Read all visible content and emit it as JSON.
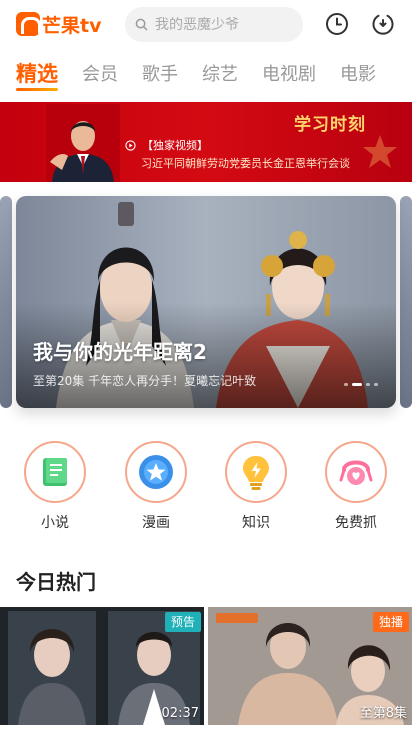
{
  "app": {
    "brand": "芒果tv"
  },
  "search": {
    "placeholder": "我的恶魔少爷"
  },
  "tabs": [
    {
      "label": "精选"
    },
    {
      "label": "会员"
    },
    {
      "label": "歌手"
    },
    {
      "label": "综艺"
    },
    {
      "label": "电视剧"
    },
    {
      "label": "电影"
    }
  ],
  "banner": {
    "title": "学习时刻",
    "tag": "【独家视频】",
    "text": "习近平同朝鲜劳动党委员长金正恩举行会谈"
  },
  "hero": {
    "title": "我与你的光年距离2",
    "subtitle": "至第20集 千年恋人再分手！夏曦忘记叶致"
  },
  "quick": [
    {
      "label": "小说",
      "icon": "book-icon"
    },
    {
      "label": "漫画",
      "icon": "comic-star-icon"
    },
    {
      "label": "知识",
      "icon": "lightbulb-icon"
    },
    {
      "label": "免费抓",
      "icon": "claw-machine-icon"
    }
  ],
  "section": {
    "title": "今日热门"
  },
  "thumbs": [
    {
      "badge": "预告",
      "meta": "02:37",
      "badge_color": "#1fb0b8"
    },
    {
      "badge": "独播",
      "meta": "至第8集",
      "badge_color": "#ff6a1a"
    }
  ],
  "colors": {
    "accent": "#ff5f00",
    "banner_red": "#c8000f"
  }
}
